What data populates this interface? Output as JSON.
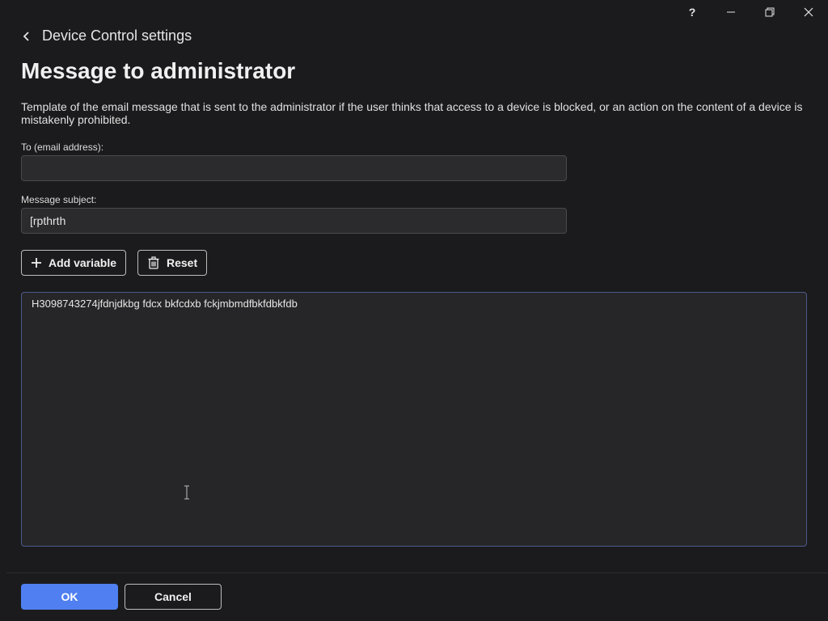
{
  "window": {
    "help_label": "?"
  },
  "breadcrumb": {
    "label": "Device Control settings"
  },
  "page": {
    "title": "Message to administrator",
    "description": "Template of the email message that is sent to the administrator if the user thinks that access to a device is blocked, or an action on the content of a device is mistakenly prohibited."
  },
  "to_field": {
    "label": "To (email address):",
    "value": ""
  },
  "subject_field": {
    "label": "Message subject:",
    "value": "[rpthrth"
  },
  "actions": {
    "add_variable_label": "Add variable",
    "reset_label": "Reset"
  },
  "message_body": {
    "value": "H3098743274jfdnjdkbg fdcx bkfcdxb fckjmbmdfbkfdbkfdb"
  },
  "footer": {
    "ok_label": "OK",
    "cancel_label": "Cancel"
  },
  "colors": {
    "background": "#1b1b1d",
    "primary": "#4f7ff0",
    "input": "#2b2b2d",
    "focus_border": "#4c5a8c"
  }
}
